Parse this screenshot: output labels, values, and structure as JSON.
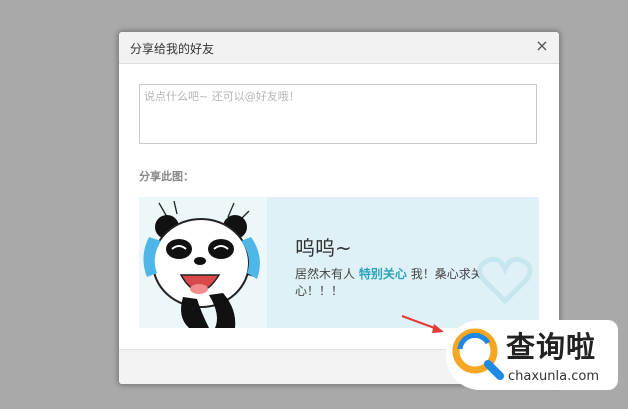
{
  "dialog": {
    "title": "分享给我的好友",
    "close_label": "×",
    "comment_placeholder": "说点什么吧~ 还可以@好友哦！",
    "share_label": "分享此图："
  },
  "share_card": {
    "title": "呜呜~",
    "desc_prefix": "居然木有人",
    "desc_link": "特别关心",
    "desc_suffix": "我！桑心求关心！！！"
  },
  "watermark": {
    "text": "查询啦",
    "url": "chaxunla.com"
  },
  "colors": {
    "link": "#2aa3b8",
    "overlay": "#a9a9a9",
    "card_bg": "#dff1f6",
    "logo_orange": "#f5a623",
    "logo_blue": "#1e88e5",
    "arrow": "#e53935"
  },
  "icons": [
    "close-icon",
    "panda-crying-sticker",
    "heart-icon",
    "magnifier-logo-icon",
    "arrow-icon"
  ]
}
